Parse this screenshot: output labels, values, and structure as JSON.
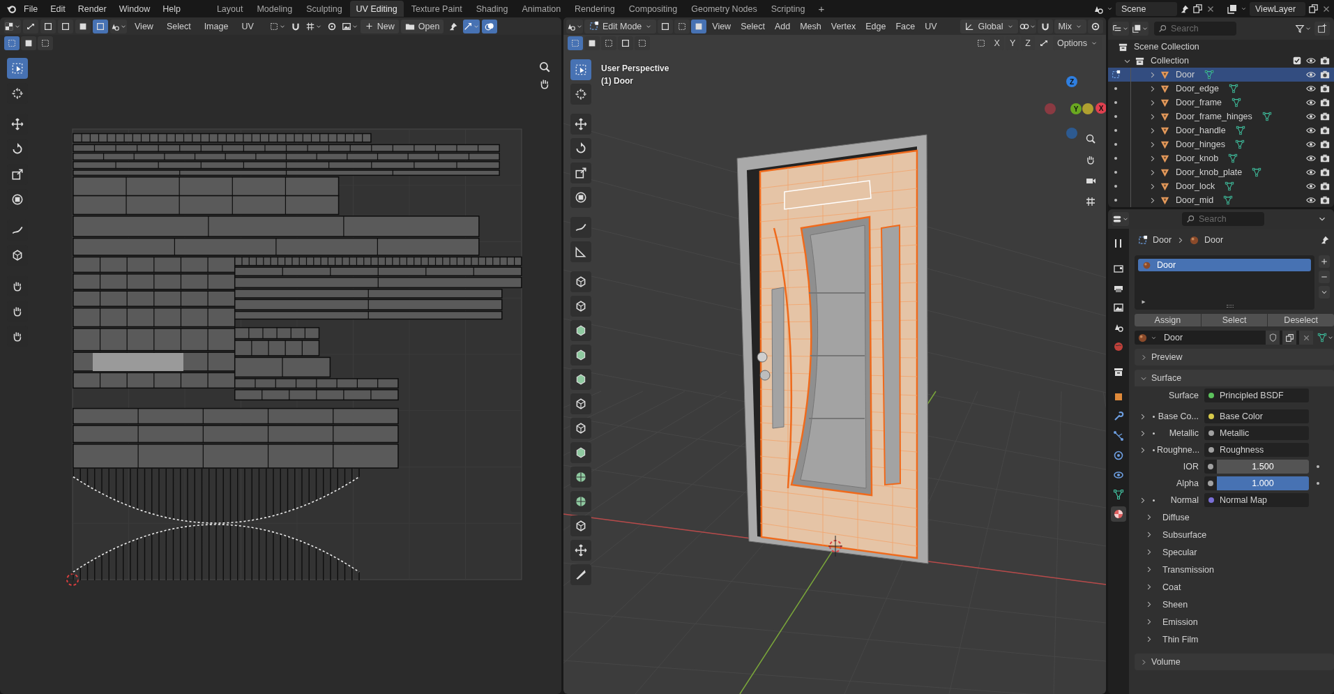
{
  "menu": [
    "File",
    "Edit",
    "Render",
    "Window",
    "Help"
  ],
  "workspaces": [
    {
      "label": "Layout",
      "selected": false
    },
    {
      "label": "Modeling",
      "selected": false
    },
    {
      "label": "Sculpting",
      "selected": false
    },
    {
      "label": "UV Editing",
      "selected": true
    },
    {
      "label": "Texture Paint",
      "selected": false
    },
    {
      "label": "Shading",
      "selected": false
    },
    {
      "label": "Animation",
      "selected": false
    },
    {
      "label": "Rendering",
      "selected": false
    },
    {
      "label": "Compositing",
      "selected": false
    },
    {
      "label": "Geometry Nodes",
      "selected": false
    },
    {
      "label": "Scripting",
      "selected": false
    }
  ],
  "add_workspace": "+",
  "scene": "Scene",
  "view_layer": "ViewLayer",
  "uv_editor": {
    "menus": [
      "View",
      "Select",
      "Image",
      "UV"
    ],
    "new_button": "New",
    "open_button": "Open",
    "select_modes": [
      {
        "selected": false
      },
      {
        "selected": false
      },
      {
        "selected": false
      },
      {
        "selected": true
      }
    ],
    "box_modes": [
      {
        "selected": true
      },
      {
        "selected": false
      },
      {
        "selected": false
      }
    ],
    "tools": [
      {
        "selected": true
      },
      {
        "selected": false
      },
      {
        "selected": false
      },
      {
        "selected": false
      },
      {
        "selected": false
      },
      {
        "selected": false
      },
      {
        "selected": false
      },
      {
        "selected": false
      },
      {
        "selected": false
      },
      {
        "selected": false
      },
      {
        "selected": false
      }
    ]
  },
  "viewport": {
    "mode": "Edit Mode",
    "menus": [
      "View",
      "Select",
      "Add",
      "Mesh",
      "Vertex",
      "Edge",
      "Face",
      "UV"
    ],
    "orientation": "Global",
    "pivot_mode": "Mix",
    "axis_buttons": [
      "X",
      "Y",
      "Z"
    ],
    "options": "Options",
    "select_modes": [
      {
        "selected": false
      },
      {
        "selected": false
      },
      {
        "selected": true
      }
    ],
    "box_modes": [
      {
        "selected": true
      },
      {
        "selected": false
      },
      {
        "selected": false
      },
      {
        "selected": false
      },
      {
        "selected": false
      }
    ],
    "overlay_title": "User Perspective",
    "overlay_object": "(1) Door",
    "gizmo": [
      {
        "label": "Z",
        "color": "#2f7fe0"
      },
      {
        "label": "Y",
        "color": "#6aa820"
      },
      {
        "label": "X",
        "color": "#e0404f"
      }
    ],
    "tools": [
      {
        "selected": true
      },
      {
        "selected": false
      },
      {
        "selected": false
      },
      {
        "selected": false
      },
      {
        "selected": false
      },
      {
        "selected": false
      },
      {
        "selected": false
      },
      {
        "selected": false
      },
      {
        "selected": false
      },
      {
        "selected": false
      },
      {
        "selected": false
      },
      {
        "selected": false
      },
      {
        "selected": false
      },
      {
        "selected": false
      },
      {
        "selected": false
      },
      {
        "selected": false
      },
      {
        "selected": false
      },
      {
        "selected": false
      },
      {
        "selected": false
      },
      {
        "selected": false
      },
      {
        "selected": false
      }
    ]
  },
  "outliner": {
    "search_placeholder": "Search",
    "scene_collection": "Scene Collection",
    "collection": {
      "label": "Collection",
      "checked": true
    },
    "objects": [
      {
        "name": "Door",
        "selected": true
      },
      {
        "name": "Door_edge",
        "selected": false
      },
      {
        "name": "Door_frame",
        "selected": false
      },
      {
        "name": "Door_frame_hinges",
        "selected": false
      },
      {
        "name": "Door_handle",
        "selected": false
      },
      {
        "name": "Door_hinges",
        "selected": false
      },
      {
        "name": "Door_knob",
        "selected": false
      },
      {
        "name": "Door_knob_plate",
        "selected": false
      },
      {
        "name": "Door_lock",
        "selected": false
      },
      {
        "name": "Door_mid",
        "selected": false
      }
    ]
  },
  "properties": {
    "search_placeholder": "Search",
    "breadcrumb": [
      "Door",
      "Door"
    ],
    "tabs": [
      {
        "selected": false
      },
      {
        "selected": false
      },
      {
        "selected": false
      },
      {
        "selected": false
      },
      {
        "selected": false
      },
      {
        "selected": false
      },
      {
        "selected": false
      },
      {
        "selected": false
      },
      {
        "selected": false
      },
      {
        "selected": false
      },
      {
        "selected": false
      },
      {
        "selected": false
      },
      {
        "selected": false
      },
      {
        "selected": true
      }
    ],
    "slots": [
      {
        "name": "Door",
        "selected": true
      }
    ],
    "slot_buttons": [
      "Assign",
      "Select",
      "Deselect"
    ],
    "material": "Door",
    "preview": {
      "label": "Preview",
      "expanded": false
    },
    "surface": {
      "label": "Surface",
      "expanded": true,
      "rows": [
        {
          "kind": "link",
          "label": "Surface",
          "value": "Principled BSDF",
          "color": "#5cc25c",
          "expandable": false
        },
        {
          "kind": "link",
          "label": "Base Co...",
          "value": "Base Color",
          "color": "#d6c94a",
          "expandable": true
        },
        {
          "kind": "link",
          "label": "Metallic",
          "value": "Metallic",
          "color": "#a1a1a1",
          "expandable": true
        },
        {
          "kind": "link",
          "label": "Roughne...",
          "value": "Roughness",
          "color": "#a1a1a1",
          "expandable": true
        },
        {
          "kind": "number",
          "label": "IOR",
          "value": "1.500",
          "color": "#a1a1a1"
        },
        {
          "kind": "slider",
          "label": "Alpha",
          "value": "1.000",
          "color": "#a1a1a1",
          "level": 1
        },
        {
          "kind": "link",
          "label": "Normal",
          "value": "Normal Map",
          "color": "#7a6fd6",
          "expandable": true
        }
      ],
      "subpanels": [
        {
          "label": "Diffuse",
          "expanded": false
        },
        {
          "label": "Subsurface",
          "expanded": false
        },
        {
          "label": "Specular",
          "expanded": false
        },
        {
          "label": "Transmission",
          "expanded": false
        },
        {
          "label": "Coat",
          "expanded": false
        },
        {
          "label": "Sheen",
          "expanded": false
        },
        {
          "label": "Emission",
          "expanded": false
        },
        {
          "label": "Thin Film",
          "expanded": false
        }
      ]
    },
    "volume": {
      "label": "Volume",
      "expanded": false
    }
  }
}
